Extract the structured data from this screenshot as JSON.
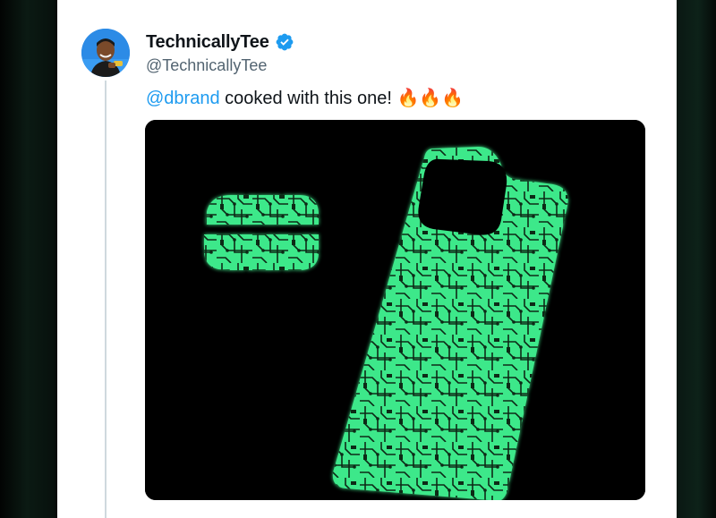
{
  "tweet": {
    "author": {
      "display_name": "TechnicallyTee",
      "handle": "@TechnicallyTee",
      "verified": true
    },
    "text": {
      "mention": "@dbrand",
      "body": " cooked with this one! ",
      "emoji": "🔥🔥🔥"
    }
  },
  "icons": {
    "verified": "verified-badge-icon",
    "avatar": "profile-avatar"
  },
  "colors": {
    "mention": "#1d9bf0",
    "text": "#0f1419",
    "secondary": "#536471",
    "glow_green": "#3cf08a",
    "media_bg": "#000000"
  }
}
